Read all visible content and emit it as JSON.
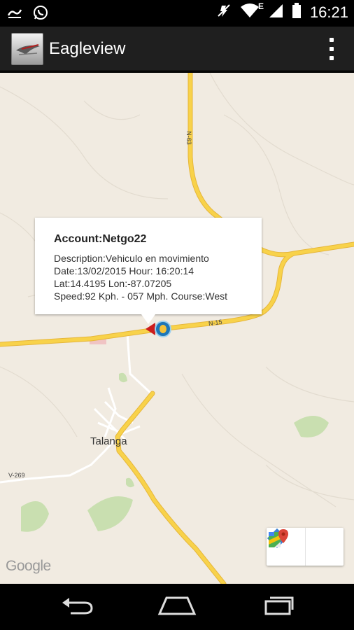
{
  "status_bar": {
    "time": "16:21",
    "carrier_letter": "E",
    "icons": [
      "notification-icon",
      "whatsapp-icon",
      "mute-icon",
      "wifi-icon",
      "signal-icon",
      "battery-icon"
    ]
  },
  "action_bar": {
    "title": "Eagleview",
    "logo": "eagleview-logo",
    "overflow": "overflow-menu-icon"
  },
  "info_window": {
    "title": "Account:Netgo22",
    "description": "Description:Vehiculo en movimiento",
    "date_hour": "Date:13/02/2015  Hour:  16:20:14",
    "lat_lon": "Lat:14.4195 Lon:-87.07205",
    "speed_course": "Speed:92 Kph.  -  057 Mph. Course:West"
  },
  "map": {
    "town_label": "Talanga",
    "road_n15": "N-15",
    "road_n63": "N-63",
    "road_v269": "V-269",
    "attribution": "Google",
    "colors": {
      "land": "#f1ebe1",
      "highway": "#f8d24a",
      "highway_edge": "#e6b63a",
      "minor_road": "#ffffff",
      "vegetation": "#c9dfb0",
      "marker": "#1d76b8",
      "direction": "#cc1d1d"
    }
  },
  "map_toolbar": {
    "directions": "directions-icon",
    "open_maps": "google-maps-icon"
  },
  "nav_bar": {
    "back": "back-icon",
    "home": "home-icon",
    "recents": "recent-apps-icon"
  }
}
